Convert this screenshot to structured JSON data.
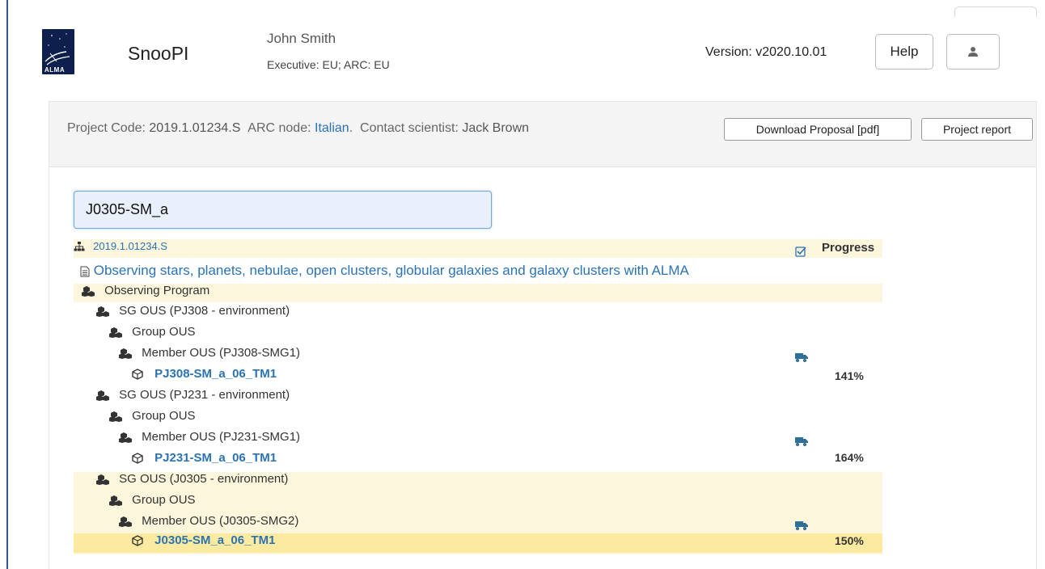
{
  "header": {
    "app_title": "SnooPI",
    "logo_text": "ALMA",
    "user_name": "John Smith",
    "user_role": "Executive: EU; ARC: EU",
    "version": "Version: v2020.10.01",
    "help_label": "Help",
    "user_icon": "user-icon"
  },
  "project": {
    "code_label": "Project Code:",
    "code_value": "2019.1.01234.S",
    "arc_label": "ARC node:",
    "arc_value": "Italian",
    "contact_label": "Contact scientist:",
    "contact_value": "Jack Brown",
    "download_label": "Download Proposal [pdf]",
    "report_label": "Project report"
  },
  "search": {
    "value": "J0305-SM_a"
  },
  "tree": {
    "root_code": "2019.1.01234.S",
    "progress_label": "Progress",
    "title": "Observing stars, planets, nebulae, open clusters, globular galaxies and galaxy clusters with ALMA",
    "observing_program": "Observing Program",
    "sg1": "SG OUS (PJ308 - environment)",
    "group1": "Group OUS",
    "member1": "Member OUS (PJ308-SMG1)",
    "sb1": "PJ308-SM_a_06_TM1",
    "pct1": "141%",
    "sg2": "SG OUS (PJ231 - environment)",
    "group2": "Group OUS",
    "member2": "Member OUS (PJ231-SMG1)",
    "sb2": "PJ231-SM_a_06_TM1",
    "pct2": "164%",
    "sg3": "SG OUS (J0305 - environment)",
    "group3": "Group OUS",
    "member3": "Member OUS (J0305-SMG2)",
    "sb3": "J0305-SM_a_06_TM1",
    "pct3": "150%"
  },
  "colors": {
    "link": "#2b73b5",
    "highlight": "#fbf6dc",
    "highlight_strong": "#fbea9f",
    "truck": "#2f6f98"
  }
}
